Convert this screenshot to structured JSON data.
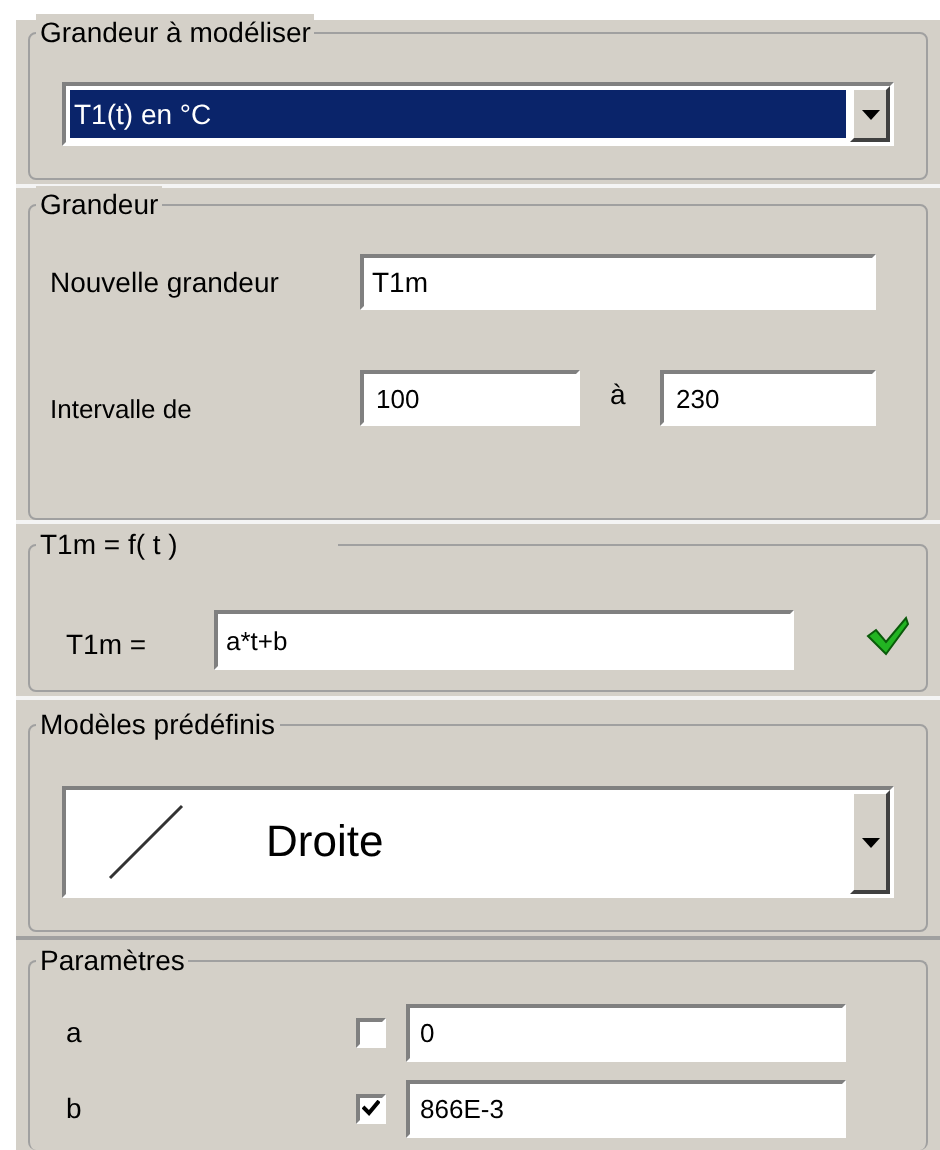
{
  "quantity_to_model": {
    "legend": "Grandeur à modéliser",
    "dropdown": {
      "value": "T1(t) en °C",
      "selected": true
    }
  },
  "quantity": {
    "legend": "Grandeur",
    "new_name_label": "Nouvelle grandeur",
    "new_name_value": "T1m",
    "interval_label": "Intervalle de",
    "interval_from": "100",
    "interval_to_label": "à",
    "interval_to": "230"
  },
  "formula": {
    "legend": "T1m = f( t )",
    "label": "T1m =",
    "value": "a*t+b",
    "valid": true
  },
  "predefined_models": {
    "legend": "Modèles prédéfinis",
    "dropdown": {
      "value": "Droite"
    }
  },
  "parameters": {
    "legend": "Paramètres",
    "rows": [
      {
        "name": "a",
        "checked": false,
        "value": "0"
      },
      {
        "name": "b",
        "checked": true,
        "value": "866E-3"
      }
    ]
  }
}
